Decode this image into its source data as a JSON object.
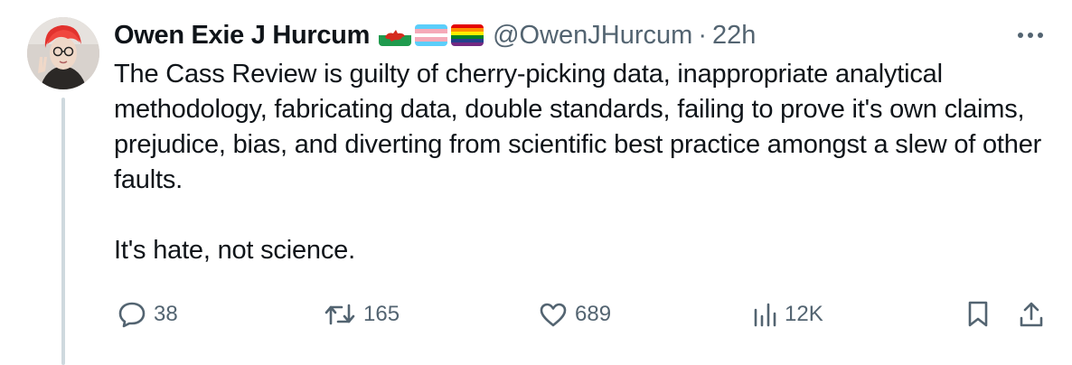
{
  "author": {
    "name": "Owen Exie J Hurcum",
    "handle": "@OwenJHurcum",
    "separator": "·",
    "time": "22h",
    "flags": [
      "welsh-flag-icon",
      "trans-flag-icon",
      "rainbow-flag-icon"
    ]
  },
  "tweet": {
    "paragraphs": [
      "The Cass Review is guilty of cherry-picking data, inappropriate analytical methodology, fabricating data, double standards, failing to prove it's own claims, prejudice, bias, and diverting from scientific best practice amongst a slew of other faults.",
      "It's hate, not science."
    ]
  },
  "stats": {
    "replies": "38",
    "retweets": "165",
    "likes": "689",
    "views": "12K"
  },
  "colors": {
    "text": "#0f1419",
    "secondary": "#536471",
    "thread_line": "#cfd9de"
  }
}
